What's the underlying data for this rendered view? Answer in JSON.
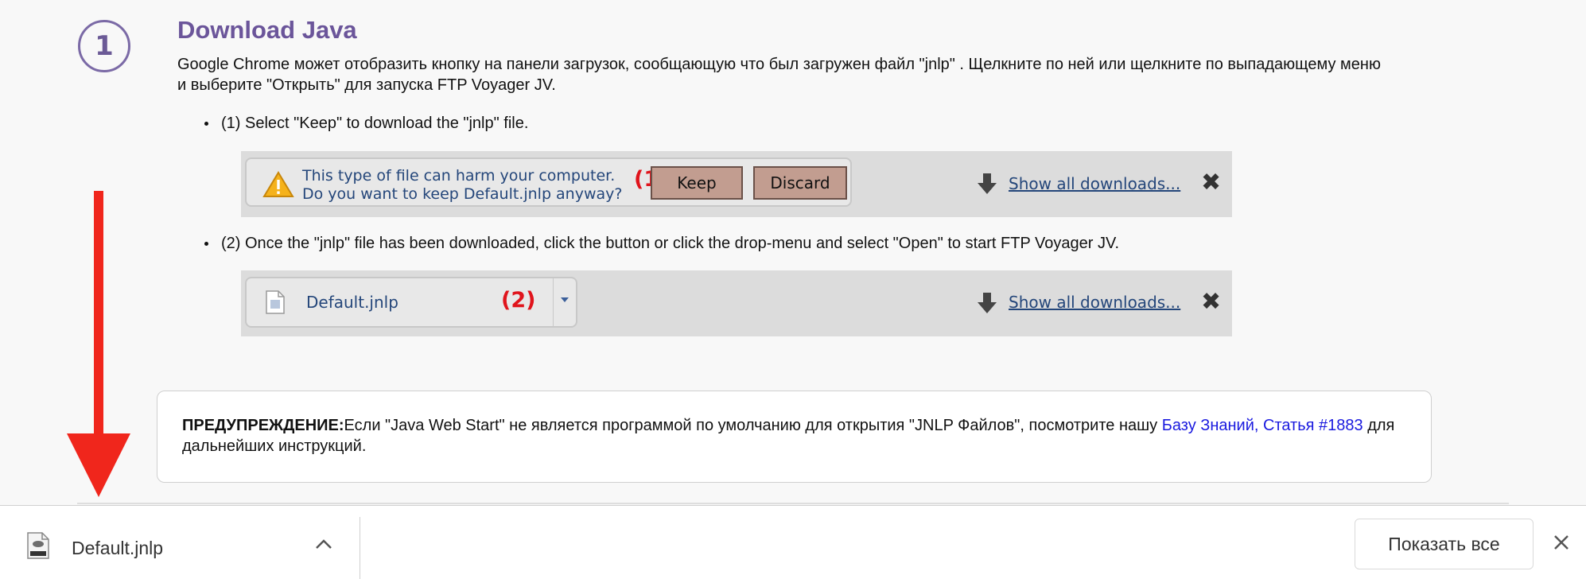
{
  "step": {
    "number": "1",
    "title": "Download Java",
    "intro": "Google Chrome может отобразить кнопку на панели загрузок, сообщающую что был загружен файл \"jnlp\" . Щелкните по ней или щелкните по выпадающему меню и выберите \"Открыть\" для запуска FTP Voyager JV."
  },
  "bullets": [
    "(1) Select \"Keep\" to download the \"jnlp\" file.",
    "(2) Once the \"jnlp\" file has been downloaded, click the button or click the drop-menu and select \"Open\" to start FTP Voyager JV."
  ],
  "screenshot1": {
    "warning_line1": "This type of file can harm your computer.",
    "warning_line2": "Do you want to keep Default.jnlp anyway?",
    "marker": "(1)",
    "keep_label": "Keep",
    "discard_label": "Discard",
    "show_all_link": "Show all downloads...",
    "close": "✖"
  },
  "screenshot2": {
    "file_name": "Default.jnlp",
    "marker": "(2)",
    "show_all_link": "Show all downloads...",
    "close": "✖"
  },
  "notice": {
    "label": "ПРЕДУПРЕЖДЕНИЕ:",
    "text_before_link": "Если \"Java Web Start\" не является программой по умолчанию для открытия \"JNLP Файлов\", посмотрите нашу ",
    "link": "Базу Знаний, Статья #1883",
    "text_after_link": " для дальнейших инструкций."
  },
  "download_bar": {
    "file_name": "Default.jnlp",
    "show_all_label": "Показать все"
  },
  "colors": {
    "title": "#6b559a",
    "marker_red": "#e0141c",
    "arrow_red": "#f0261c",
    "link_blue": "#1a1adf"
  }
}
